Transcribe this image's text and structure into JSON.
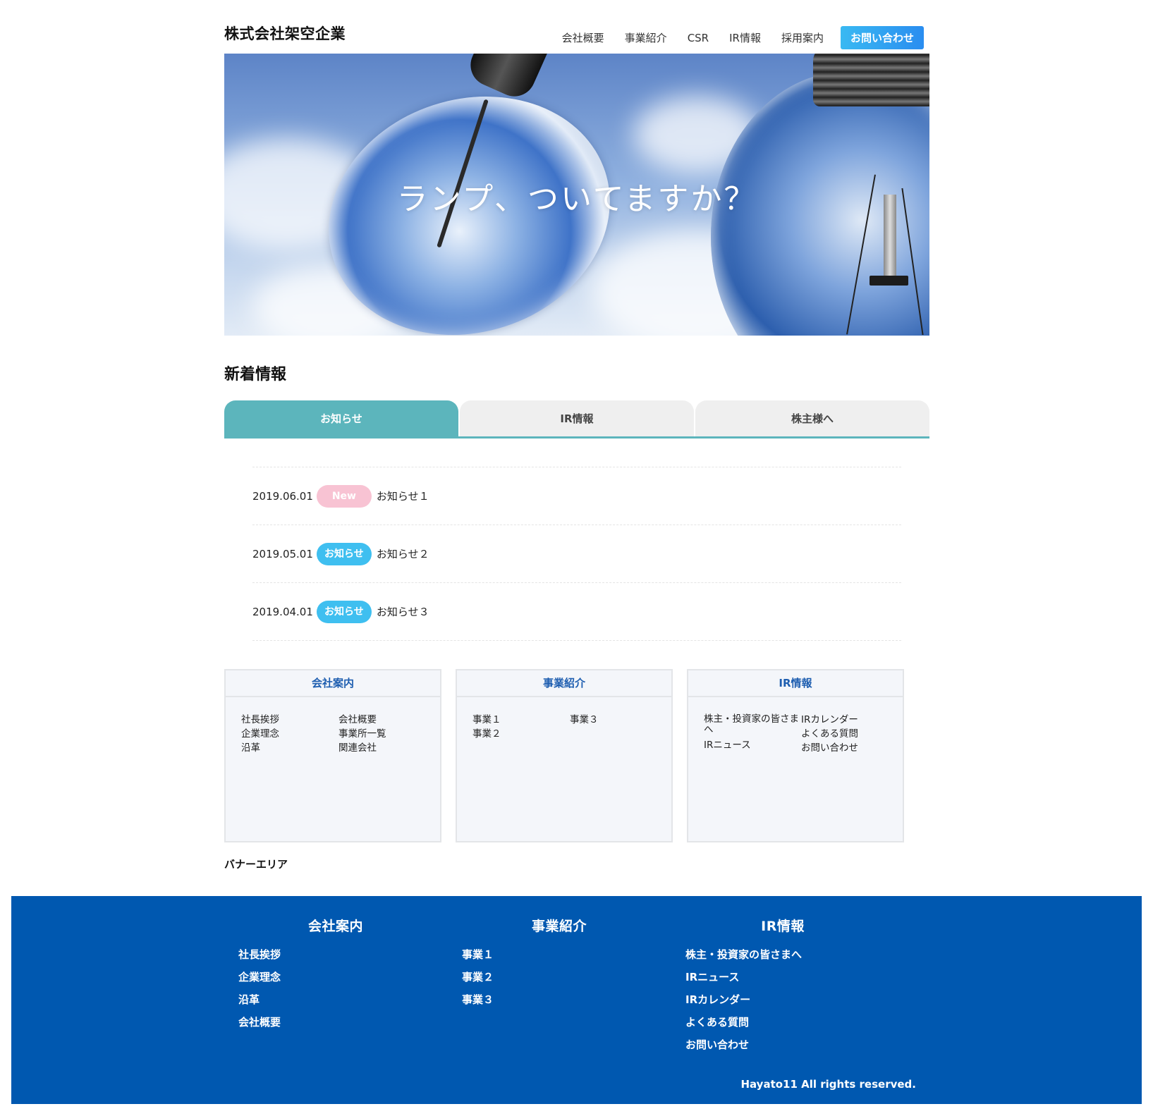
{
  "header": {
    "logo": "株式会社架空企業",
    "nav": [
      "会社概要",
      "事業紹介",
      "CSR",
      "IR情報",
      "採用案内"
    ],
    "cta": "お問い合わせ"
  },
  "hero": {
    "text": "ランプ、ついてますか？"
  },
  "news": {
    "title": "新着情報",
    "tabs": [
      "お知らせ",
      "IR情報",
      "株主様へ"
    ],
    "active_tab": "お知らせ",
    "items": [
      {
        "date": "2019.06.01",
        "badge": "New",
        "text": "お知らせ１"
      },
      {
        "date": "2019.05.01",
        "badge": "お知らせ",
        "text": "お知らせ２"
      },
      {
        "date": "2019.04.01",
        "badge": "お知らせ",
        "text": "お知らせ３"
      }
    ]
  },
  "cards": [
    {
      "title": "会社案内",
      "col1": [
        "社長挨拶",
        "企業理念",
        "沿革"
      ],
      "col2": [
        "会社概要",
        "事業所一覧",
        "関連会社"
      ]
    },
    {
      "title": "事業紹介",
      "col1": [
        "事業１",
        "事業２"
      ],
      "col2": [
        "事業３"
      ]
    },
    {
      "title": "IR情報",
      "col1": [
        "株主・投資家の皆さまへ",
        "IRニュース"
      ],
      "col2": [
        "IRカレンダー",
        "よくある質問",
        "お問い合わせ"
      ]
    }
  ],
  "banner": {
    "title": "バナーエリア"
  },
  "footer": {
    "columns": [
      {
        "title": "会社案内",
        "links": [
          "社長挨拶",
          "企業理念",
          "沿革",
          "会社概要"
        ]
      },
      {
        "title": "事業紹介",
        "links": [
          "事業１",
          "事業２",
          "事業３"
        ]
      },
      {
        "title": "IR情報",
        "links": [
          "株主・投資家の皆さまへ",
          "IRニュース",
          "IRカレンダー",
          "よくある質問",
          "お問い合わせ"
        ]
      }
    ],
    "copyright": "Hayato11 All rights reserved."
  },
  "colors": {
    "cta_gradient": [
      "#39b9f2",
      "#2a8df0"
    ],
    "tab_active": "#5cb5bc",
    "badge_new": "#f8c3d3",
    "badge_info": "#3fbff0",
    "card_title": "#1e5eb0",
    "footer_bg": "#0058b0"
  }
}
